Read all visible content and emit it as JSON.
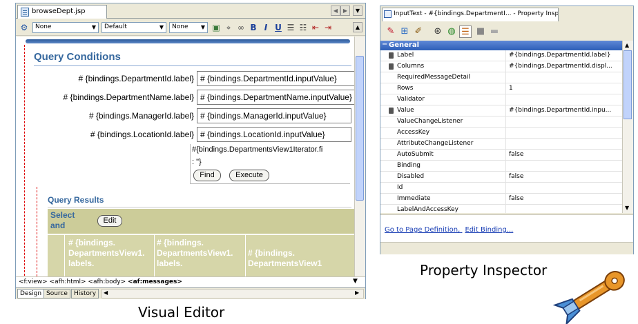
{
  "visual_editor": {
    "tab_title": "browseDept.jsp",
    "toolbar": {
      "style_select": "None",
      "font_select": "Default",
      "size_select": "None",
      "bold": "B",
      "italic": "I",
      "underline": "U"
    },
    "query_title": "Query Conditions",
    "fields": [
      {
        "label": "# {bindings.DepartmentId.label}",
        "value": "# {bindings.DepartmentId.inputValue}"
      },
      {
        "label": "# {bindings.DepartmentName.label}",
        "value": "# {bindings.DepartmentName.inputValue}"
      },
      {
        "label": "# {bindings.ManagerId.label}",
        "value": "# {bindings.ManagerId.inputValue}"
      },
      {
        "label": "# {bindings.LocationId.label}",
        "value": "# {bindings.LocationId.inputValue}"
      }
    ],
    "iterator_text": "#{bindings.DepartmentsView1Iterator.fi",
    "iterator_text2": ": \"}",
    "find_button": "Find",
    "execute_button": "Execute",
    "results_title": "Query Results",
    "select_label_1": "Select",
    "select_label_2": "and",
    "edit_button": "Edit",
    "columns": [
      {
        "line1": "# {bindings.",
        "line2": "DepartmentsView1.",
        "line3": "labels."
      },
      {
        "line1": "# {bindings.",
        "line2": "DepartmentsView1.",
        "line3": "labels."
      },
      {
        "line1": "# {bindings.",
        "line2": "DepartmentsView1",
        "line3": ""
      }
    ],
    "status_path": {
      "plain": "<f:view> <afh:html> <afh:body> ",
      "bold": "<af:messages>"
    },
    "bottom_tabs": [
      "Design",
      "Source",
      "History"
    ],
    "caption": "Visual Editor"
  },
  "property_inspector": {
    "tab_title": "InputText - #{bindings.DepartmentI... - Property Inspector",
    "category": "General",
    "properties": [
      {
        "name": "Label",
        "value": "#{bindings.DepartmentId.label}",
        "key": true
      },
      {
        "name": "Columns",
        "value": "#{bindings.DepartmentId.displ...",
        "key": true
      },
      {
        "name": "RequiredMessageDetail",
        "value": "",
        "key": false
      },
      {
        "name": "Rows",
        "value": "1",
        "key": false
      },
      {
        "name": "Validator",
        "value": "",
        "key": false
      },
      {
        "name": "Value",
        "value": "#{bindings.DepartmentId.inpu...",
        "key": true
      },
      {
        "name": "ValueChangeListener",
        "value": "",
        "key": false
      },
      {
        "name": "AccessKey",
        "value": "",
        "key": false
      },
      {
        "name": "AttributeChangeListener",
        "value": "",
        "key": false
      },
      {
        "name": "AutoSubmit",
        "value": "false",
        "key": false
      },
      {
        "name": "Binding",
        "value": "",
        "key": false
      },
      {
        "name": "Disabled",
        "value": "false",
        "key": false
      },
      {
        "name": "Id",
        "value": "",
        "key": false
      },
      {
        "name": "Immediate",
        "value": "false",
        "key": false
      },
      {
        "name": "LabelAndAccessKey",
        "value": "",
        "key": false
      }
    ],
    "link_page_definition": "Go to Page Definition,",
    "link_edit_binding": "Edit Binding...",
    "caption": "Property Inspector"
  }
}
